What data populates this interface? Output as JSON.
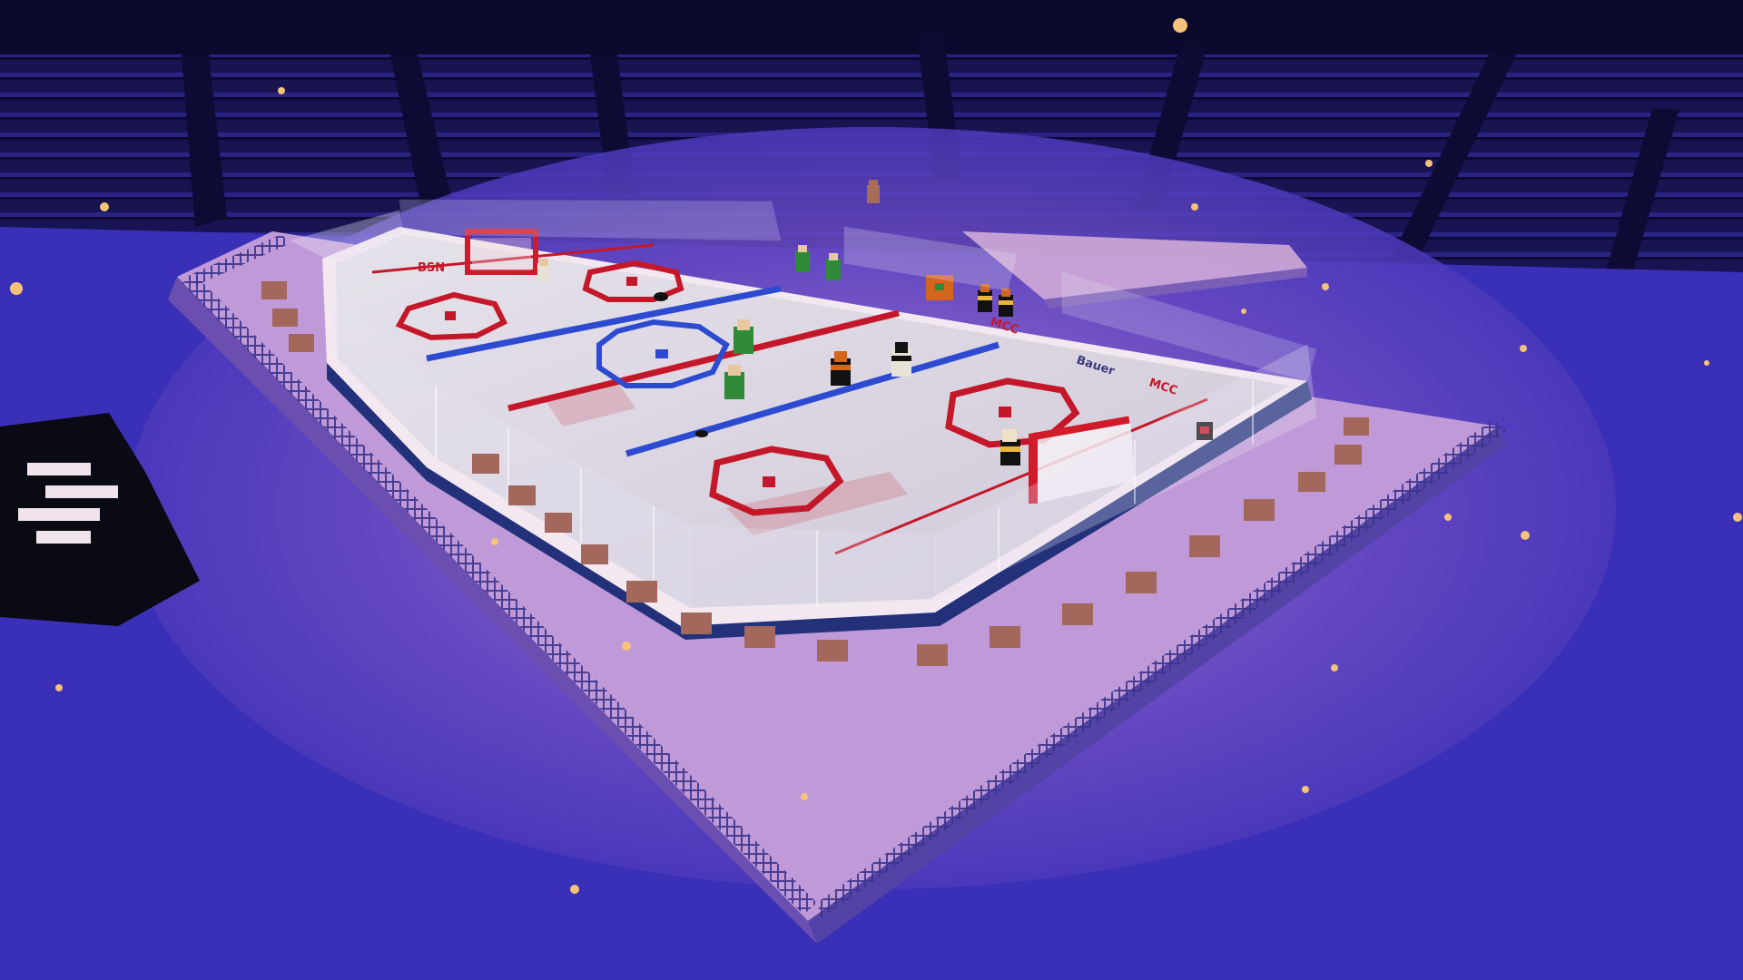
{
  "scene": {
    "title": "",
    "colors": {
      "floor": "#3b2fb8",
      "floor_glow": "#8f63c9",
      "stands": "#1a1760",
      "ice": "#dcd7e2",
      "red_line": "#c4182a",
      "blue_line": "#2d4bd0",
      "team_green": "#2f8a3a",
      "team_orange": "#d2661c",
      "particle": "#f5c27a"
    },
    "ads": {
      "far_board_1": "BSN",
      "near_board_1": "MCC",
      "near_board_2": "MCC",
      "near_board_3": "Bauer"
    },
    "players": {
      "green_team_count": 5,
      "orange_team_count": 6
    }
  }
}
